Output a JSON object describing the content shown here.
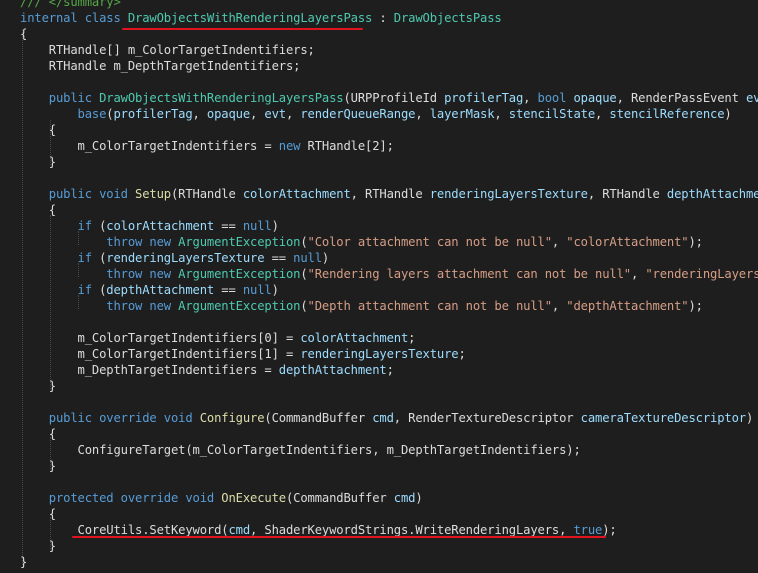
{
  "colors": {
    "background": "#1e1e1e",
    "text": "#dcdcdc",
    "keyword": "#569cd6",
    "type": "#4ec9b0",
    "method": "#dcdcaa",
    "parameter": "#9cdcfe",
    "string": "#d69d85",
    "comment": "#57a64a",
    "highlight_underline": "#e0141e"
  },
  "code": {
    "lines": [
      [
        [
          "comment",
          "/// </summary>"
        ]
      ],
      [
        [
          "kw",
          "internal "
        ],
        [
          "kw",
          "class "
        ],
        [
          "type",
          "DrawObjectsWithRenderingLayersPass"
        ],
        [
          "text",
          " : "
        ],
        [
          "type",
          "DrawObjectsPass"
        ]
      ],
      [
        [
          "text",
          "{"
        ]
      ],
      [
        [
          "text",
          "    RTHandle[] m_ColorTargetIndentifiers;"
        ]
      ],
      [
        [
          "text",
          "    RTHandle m_DepthTargetIndentifiers;"
        ]
      ],
      [],
      [
        [
          "text",
          "    "
        ],
        [
          "kw",
          "public "
        ],
        [
          "type",
          "DrawObjectsWithRenderingLayersPass"
        ],
        [
          "text",
          "(URPProfileId "
        ],
        [
          "param",
          "profilerTag"
        ],
        [
          "text",
          ", "
        ],
        [
          "kw",
          "bool "
        ],
        [
          "param",
          "opaque"
        ],
        [
          "text",
          ", RenderPassEvent "
        ],
        [
          "param",
          "evt"
        ],
        [
          "text",
          ","
        ]
      ],
      [
        [
          "text",
          "        "
        ],
        [
          "kw",
          "base"
        ],
        [
          "text",
          "("
        ],
        [
          "param",
          "profilerTag"
        ],
        [
          "text",
          ", "
        ],
        [
          "param",
          "opaque"
        ],
        [
          "text",
          ", "
        ],
        [
          "param",
          "evt"
        ],
        [
          "text",
          ", "
        ],
        [
          "param",
          "renderQueueRange"
        ],
        [
          "text",
          ", "
        ],
        [
          "param",
          "layerMask"
        ],
        [
          "text",
          ", "
        ],
        [
          "param",
          "stencilState"
        ],
        [
          "text",
          ", "
        ],
        [
          "param",
          "stencilReference"
        ],
        [
          "text",
          ")"
        ]
      ],
      [
        [
          "text",
          "    {"
        ]
      ],
      [
        [
          "text",
          "        m_ColorTargetIndentifiers = "
        ],
        [
          "kw",
          "new "
        ],
        [
          "text",
          "RTHandle[2];"
        ]
      ],
      [
        [
          "text",
          "    }"
        ]
      ],
      [],
      [
        [
          "text",
          "    "
        ],
        [
          "kw",
          "public "
        ],
        [
          "kw",
          "void "
        ],
        [
          "method",
          "Setup"
        ],
        [
          "text",
          "(RTHandle "
        ],
        [
          "param",
          "colorAttachment"
        ],
        [
          "text",
          ", RTHandle "
        ],
        [
          "param",
          "renderingLayersTexture"
        ],
        [
          "text",
          ", RTHandle "
        ],
        [
          "param",
          "depthAttachment"
        ]
      ],
      [
        [
          "text",
          "    {"
        ]
      ],
      [
        [
          "text",
          "        "
        ],
        [
          "kw",
          "if "
        ],
        [
          "text",
          "("
        ],
        [
          "param",
          "colorAttachment"
        ],
        [
          "text",
          " == "
        ],
        [
          "kw",
          "null"
        ],
        [
          "text",
          ")"
        ]
      ],
      [
        [
          "text",
          "            "
        ],
        [
          "kw",
          "throw "
        ],
        [
          "kw",
          "new "
        ],
        [
          "type",
          "ArgumentException"
        ],
        [
          "text",
          "("
        ],
        [
          "string",
          "\"Color attachment can not be null\""
        ],
        [
          "text",
          ", "
        ],
        [
          "string",
          "\"colorAttachment\""
        ],
        [
          "text",
          ");"
        ]
      ],
      [
        [
          "text",
          "        "
        ],
        [
          "kw",
          "if "
        ],
        [
          "text",
          "("
        ],
        [
          "param",
          "renderingLayersTexture"
        ],
        [
          "text",
          " == "
        ],
        [
          "kw",
          "null"
        ],
        [
          "text",
          ")"
        ]
      ],
      [
        [
          "text",
          "            "
        ],
        [
          "kw",
          "throw "
        ],
        [
          "kw",
          "new "
        ],
        [
          "type",
          "ArgumentException"
        ],
        [
          "text",
          "("
        ],
        [
          "string",
          "\"Rendering layers attachment can not be null\""
        ],
        [
          "text",
          ", "
        ],
        [
          "string",
          "\"renderingLayersTex"
        ]
      ],
      [
        [
          "text",
          "        "
        ],
        [
          "kw",
          "if "
        ],
        [
          "text",
          "("
        ],
        [
          "param",
          "depthAttachment"
        ],
        [
          "text",
          " == "
        ],
        [
          "kw",
          "null"
        ],
        [
          "text",
          ")"
        ]
      ],
      [
        [
          "text",
          "            "
        ],
        [
          "kw",
          "throw "
        ],
        [
          "kw",
          "new "
        ],
        [
          "type",
          "ArgumentException"
        ],
        [
          "text",
          "("
        ],
        [
          "string",
          "\"Depth attachment can not be null\""
        ],
        [
          "text",
          ", "
        ],
        [
          "string",
          "\"depthAttachment\""
        ],
        [
          "text",
          ");"
        ]
      ],
      [],
      [
        [
          "text",
          "        m_ColorTargetIndentifiers[0] = "
        ],
        [
          "param",
          "colorAttachment"
        ],
        [
          "text",
          ";"
        ]
      ],
      [
        [
          "text",
          "        m_ColorTargetIndentifiers[1] = "
        ],
        [
          "param",
          "renderingLayersTexture"
        ],
        [
          "text",
          ";"
        ]
      ],
      [
        [
          "text",
          "        m_DepthTargetIndentifiers = "
        ],
        [
          "param",
          "depthAttachment"
        ],
        [
          "text",
          ";"
        ]
      ],
      [
        [
          "text",
          "    }"
        ]
      ],
      [],
      [
        [
          "text",
          "    "
        ],
        [
          "kw",
          "public "
        ],
        [
          "kw",
          "override "
        ],
        [
          "kw",
          "void "
        ],
        [
          "method",
          "Configure"
        ],
        [
          "text",
          "(CommandBuffer "
        ],
        [
          "param",
          "cmd"
        ],
        [
          "text",
          ", RenderTextureDescriptor "
        ],
        [
          "param",
          "cameraTextureDescriptor"
        ],
        [
          "text",
          ")"
        ]
      ],
      [
        [
          "text",
          "    {"
        ]
      ],
      [
        [
          "text",
          "        ConfigureTarget(m_ColorTargetIndentifiers, m_DepthTargetIndentifiers);"
        ]
      ],
      [
        [
          "text",
          "    }"
        ]
      ],
      [],
      [
        [
          "text",
          "    "
        ],
        [
          "kw",
          "protected "
        ],
        [
          "kw",
          "override "
        ],
        [
          "kw",
          "void "
        ],
        [
          "method",
          "OnExecute"
        ],
        [
          "text",
          "(CommandBuffer "
        ],
        [
          "param",
          "cmd"
        ],
        [
          "text",
          ")"
        ]
      ],
      [
        [
          "text",
          "    {"
        ]
      ],
      [
        [
          "text",
          "        CoreUtils.SetKeyword("
        ],
        [
          "param",
          "cmd"
        ],
        [
          "text",
          ", ShaderKeywordStrings.WriteRenderingLayers, "
        ],
        [
          "kw",
          "true"
        ],
        [
          "text",
          ");"
        ]
      ],
      [
        [
          "text",
          "    }"
        ]
      ],
      [
        [
          "text",
          "}"
        ]
      ]
    ]
  }
}
